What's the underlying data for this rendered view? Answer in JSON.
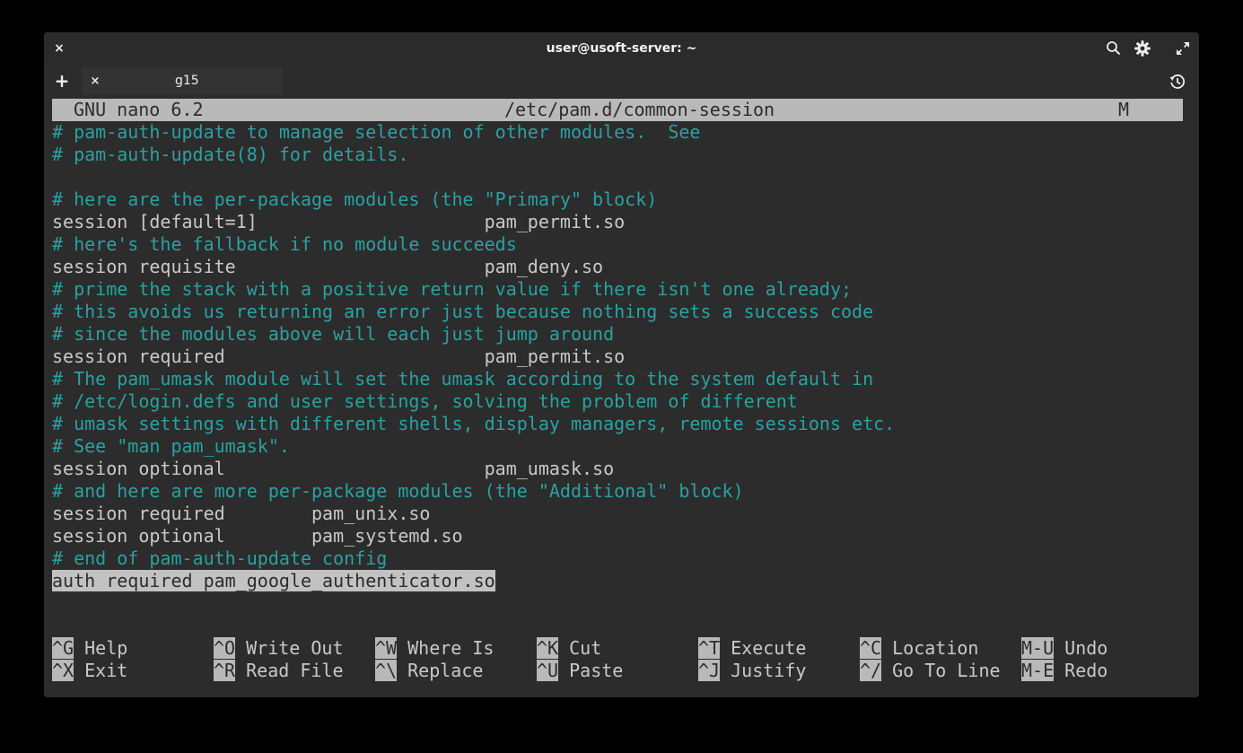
{
  "titlebar": {
    "title": "user@usoft-server: ~",
    "close_glyph": "×"
  },
  "tabs": {
    "new_tab_glyph": "+",
    "items": [
      {
        "label": "g15",
        "close_glyph": "×"
      }
    ]
  },
  "editor": {
    "header": {
      "app": "GNU nano 6.2",
      "file": "/etc/pam.d/common-session",
      "modified_flag": "M"
    },
    "lines": [
      {
        "text": "# pam-auth-update to manage selection of other modules.  See",
        "kind": "comment"
      },
      {
        "text": "# pam-auth-update(8) for details.",
        "kind": "comment"
      },
      {
        "text": "",
        "kind": "code"
      },
      {
        "text": "# here are the per-package modules (the \"Primary\" block)",
        "kind": "comment"
      },
      {
        "text": "session [default=1]                     pam_permit.so",
        "kind": "code"
      },
      {
        "text": "# here's the fallback if no module succeeds",
        "kind": "comment"
      },
      {
        "text": "session requisite                       pam_deny.so",
        "kind": "code"
      },
      {
        "text": "# prime the stack with a positive return value if there isn't one already;",
        "kind": "comment"
      },
      {
        "text": "# this avoids us returning an error just because nothing sets a success code",
        "kind": "comment"
      },
      {
        "text": "# since the modules above will each just jump around",
        "kind": "comment"
      },
      {
        "text": "session required                        pam_permit.so",
        "kind": "code"
      },
      {
        "text": "# The pam_umask module will set the umask according to the system default in",
        "kind": "comment"
      },
      {
        "text": "# /etc/login.defs and user settings, solving the problem of different",
        "kind": "comment"
      },
      {
        "text": "# umask settings with different shells, display managers, remote sessions etc.",
        "kind": "comment"
      },
      {
        "text": "# See \"man pam_umask\".",
        "kind": "comment"
      },
      {
        "text": "session optional                        pam_umask.so",
        "kind": "code"
      },
      {
        "text": "# and here are more per-package modules (the \"Additional\" block)",
        "kind": "comment"
      },
      {
        "text": "session required        pam_unix.so",
        "kind": "code"
      },
      {
        "text": "session optional        pam_systemd.so",
        "kind": "code"
      },
      {
        "text": "# end of pam-auth-update config",
        "kind": "comment"
      },
      {
        "text": "auth required pam_google_authenticator.so",
        "kind": "selected"
      }
    ],
    "shortcuts": [
      [
        {
          "key": "^G",
          "label": "Help"
        },
        {
          "key": "^O",
          "label": "Write Out"
        },
        {
          "key": "^W",
          "label": "Where Is"
        },
        {
          "key": "^K",
          "label": "Cut"
        },
        {
          "key": "^T",
          "label": "Execute"
        },
        {
          "key": "^C",
          "label": "Location"
        },
        {
          "key": "M-U",
          "label": "Undo"
        }
      ],
      [
        {
          "key": "^X",
          "label": "Exit"
        },
        {
          "key": "^R",
          "label": "Read File"
        },
        {
          "key": "^\\",
          "label": "Replace"
        },
        {
          "key": "^U",
          "label": "Paste"
        },
        {
          "key": "^J",
          "label": "Justify"
        },
        {
          "key": "^/",
          "label": "Go To Line"
        },
        {
          "key": "M-E",
          "label": "Redo"
        }
      ]
    ]
  },
  "icons": {
    "search": "search-icon",
    "settings": "gear-icon",
    "maximize": "maximize-icon",
    "history": "history-icon"
  },
  "colors": {
    "comment": "#2aa1a1",
    "code": "#c9c9c9",
    "header_bg": "#b9b9b9",
    "window_bg": "#2c2c2c"
  }
}
